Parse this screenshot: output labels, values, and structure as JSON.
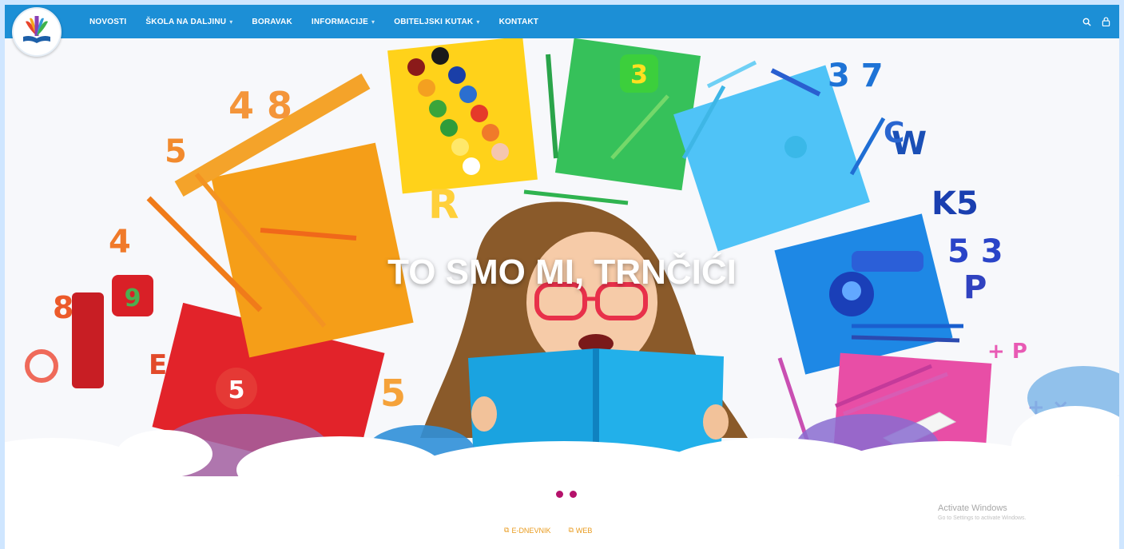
{
  "nav": {
    "items": [
      {
        "label": "Novosti",
        "dropdown": false
      },
      {
        "label": "Škola na daljinu",
        "dropdown": true
      },
      {
        "label": "Boravak",
        "dropdown": false
      },
      {
        "label": "Informacije",
        "dropdown": true
      },
      {
        "label": "Obiteljski kutak",
        "dropdown": true
      },
      {
        "label": "Kontakt",
        "dropdown": false
      }
    ],
    "icons": [
      "search-icon",
      "user-icon"
    ],
    "color": "#1c8fd6"
  },
  "hero": {
    "title": "TO SMO MI, TRNČIĆI"
  },
  "slider": {
    "dots": 2,
    "dot_color": "#b5126b"
  },
  "links": [
    {
      "label": "E-DNEVNIK"
    },
    {
      "label": "WEB"
    }
  ],
  "watermark": {
    "title": "Activate Windows",
    "subtitle": "Go to Settings to activate Windows."
  }
}
